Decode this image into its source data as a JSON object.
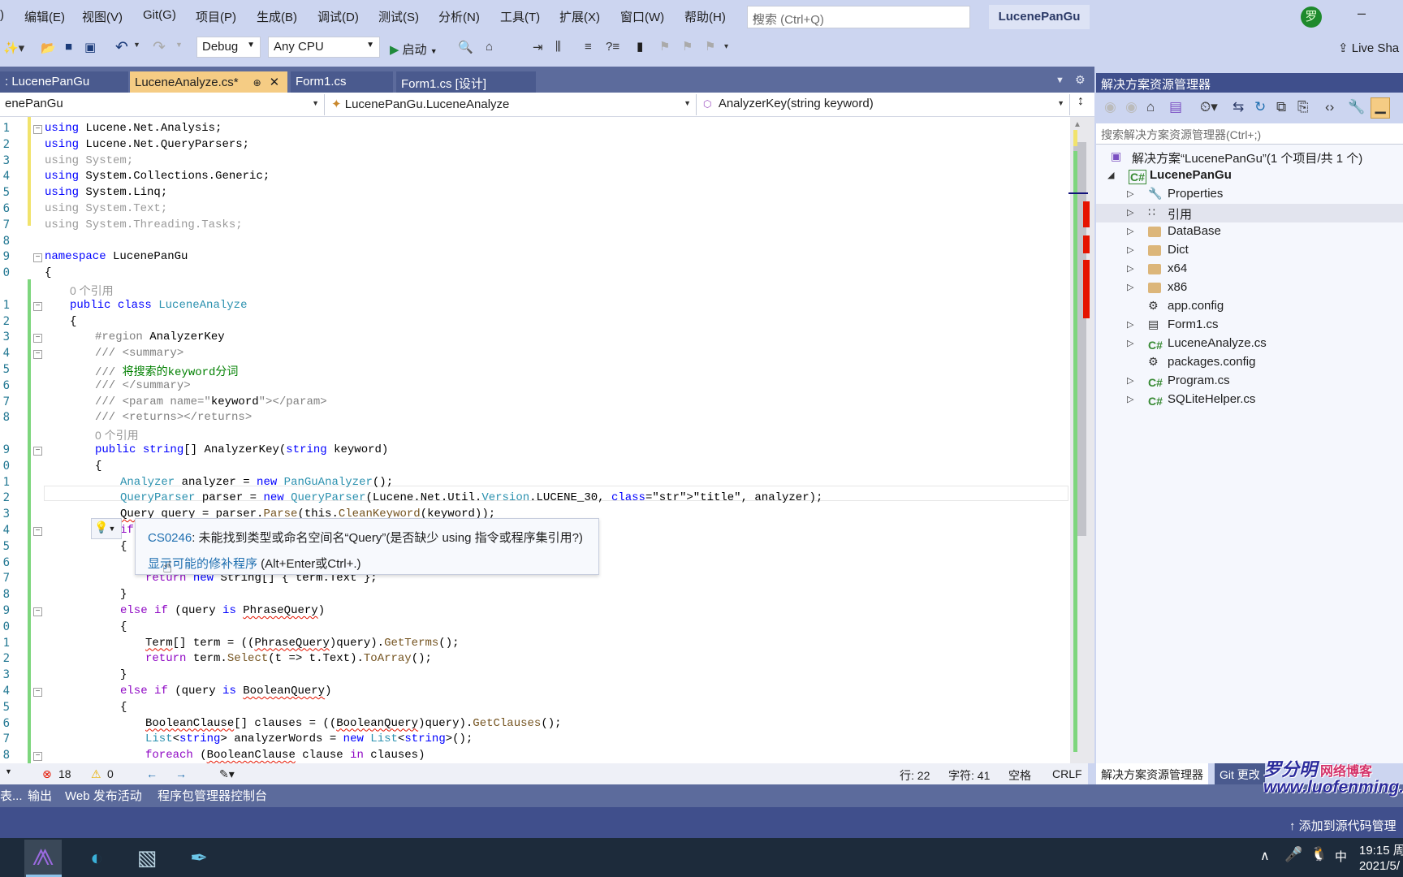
{
  "menu": [
    "编辑(E)",
    "视图(V)",
    "Git(G)",
    "项目(P)",
    "生成(B)",
    "调试(D)",
    "测试(S)",
    "分析(N)",
    "工具(T)",
    "扩展(X)",
    "窗口(W)",
    "帮助(H)"
  ],
  "menu_partial_first": ")",
  "search": {
    "placeholder": "搜索 (Ctrl+Q)"
  },
  "solution_name": "LucenePanGu",
  "avatar_initial": "罗",
  "toolbar": {
    "config": "Debug",
    "platform": "Any CPU",
    "start": "启动",
    "live_share": "Live Sha"
  },
  "tabs": [
    {
      "label": ": LucenePanGu",
      "active": false
    },
    {
      "label": "LuceneAnalyze.cs*",
      "active": true
    },
    {
      "label": "Form1.cs",
      "active": false
    },
    {
      "label": "Form1.cs [设计]",
      "active": false
    }
  ],
  "nav": {
    "project": "enePanGu",
    "type": "LucenePanGu.LuceneAnalyze",
    "member": "AnalyzerKey(string keyword)"
  },
  "code_lines": [
    {
      "n": "1",
      "text": "using Lucene.Net.Analysis;"
    },
    {
      "n": "2",
      "text": "using Lucene.Net.QueryParsers;"
    },
    {
      "n": "3",
      "text": "using System;"
    },
    {
      "n": "4",
      "text": "using System.Collections.Generic;"
    },
    {
      "n": "5",
      "text": "using System.Linq;"
    },
    {
      "n": "6",
      "text": "using System.Text;"
    },
    {
      "n": "7",
      "text": "using System.Threading.Tasks;"
    },
    {
      "n": "8",
      "text": ""
    },
    {
      "n": "9",
      "text": "namespace LucenePanGu"
    },
    {
      "n": "0",
      "text": "{"
    },
    {
      "n": "",
      "text": "0 个引用"
    },
    {
      "n": "1",
      "text": "public class LuceneAnalyze"
    },
    {
      "n": "2",
      "text": "{"
    },
    {
      "n": "3",
      "text": "#region AnalyzerKey"
    },
    {
      "n": "4",
      "text": "/// <summary>"
    },
    {
      "n": "5",
      "text": "/// 将搜索的keyword分词"
    },
    {
      "n": "6",
      "text": "/// </summary>"
    },
    {
      "n": "7",
      "text": "/// <param name=\"keyword\"></param>"
    },
    {
      "n": "8",
      "text": "/// <returns></returns>"
    },
    {
      "n": "",
      "text": "0 个引用"
    },
    {
      "n": "9",
      "text": "public string[] AnalyzerKey(string keyword)"
    },
    {
      "n": "0",
      "text": "{"
    },
    {
      "n": "1",
      "text": "Analyzer analyzer = new PanGuAnalyzer();"
    },
    {
      "n": "2",
      "text": "QueryParser parser = new QueryParser(Lucene.Net.Util.Version.LUCENE_30, \"title\", analyzer);"
    },
    {
      "n": "3",
      "text": "Query query = parser.Parse(this.CleanKeyword(keyword));"
    },
    {
      "n": "4",
      "text": "if"
    },
    {
      "n": "5",
      "text": "{"
    },
    {
      "n": "6",
      "text": ""
    },
    {
      "n": "7",
      "text": "return new String[] { term.Text };"
    },
    {
      "n": "8",
      "text": "}"
    },
    {
      "n": "9",
      "text": "else if (query is PhraseQuery)"
    },
    {
      "n": "0",
      "text": "{"
    },
    {
      "n": "1",
      "text": "Term[] term = ((PhraseQuery)query).GetTerms();"
    },
    {
      "n": "2",
      "text": "return term.Select(t => t.Text).ToArray();"
    },
    {
      "n": "3",
      "text": "}"
    },
    {
      "n": "4",
      "text": "else if (query is BooleanQuery)"
    },
    {
      "n": "5",
      "text": "{"
    },
    {
      "n": "6",
      "text": "BooleanClause[] clauses = ((BooleanQuery)query).GetClauses();"
    },
    {
      "n": "7",
      "text": "List<string> analyzerWords = new List<string>();"
    },
    {
      "n": "8",
      "text": "foreach (BooleanClause clause in clauses)"
    }
  ],
  "quickinfo": {
    "error_code": "CS0246",
    "error_text": ": 未能找到类型或命名空间名“Query”(是否缺少 using 指令或程序集引用?)",
    "fix_link": "显示可能的修补程序",
    "fix_shortcut": " (Alt+Enter或Ctrl+.)"
  },
  "status": {
    "errors": "18",
    "warnings": "0",
    "line": "行: 22",
    "char": "字符: 41",
    "indent": "空格",
    "eol": "CRLF"
  },
  "solution_explorer": {
    "title": "解决方案资源管理器",
    "search_placeholder": "搜索解决方案资源管理器(Ctrl+;)",
    "solution_label": "解决方案“LucenePanGu”(1 个项目/共 1 个)",
    "project": "LucenePanGu",
    "items": [
      {
        "label": "Properties",
        "icon": "wrench",
        "expandable": true
      },
      {
        "label": "引用",
        "icon": "references",
        "expandable": true,
        "selected": true
      },
      {
        "label": "DataBase",
        "icon": "folder",
        "expandable": true
      },
      {
        "label": "Dict",
        "icon": "folder",
        "expandable": true
      },
      {
        "label": "x64",
        "icon": "folder",
        "expandable": true
      },
      {
        "label": "x86",
        "icon": "folder",
        "expandable": true
      },
      {
        "label": "app.config",
        "icon": "config",
        "expandable": false
      },
      {
        "label": "Form1.cs",
        "icon": "form",
        "expandable": true
      },
      {
        "label": "LuceneAnalyze.cs",
        "icon": "csharp",
        "expandable": true
      },
      {
        "label": "packages.config",
        "icon": "config",
        "expandable": false
      },
      {
        "label": "Program.cs",
        "icon": "csharp",
        "expandable": true
      },
      {
        "label": "SQLiteHelper.cs",
        "icon": "csharp",
        "expandable": true
      }
    ],
    "bottom_tabs": [
      "解决方案资源管理器",
      "Git 更改"
    ]
  },
  "output_tabs": [
    "表...",
    "输出",
    "Web 发布活动",
    "程序包管理器控制台"
  ],
  "source_control": "添加到源代码管理",
  "taskbar": {
    "time": "19:15 周",
    "date": "2021/5/",
    "ime": "中"
  },
  "watermark": {
    "name": "罗分明",
    "tag": "网络博客",
    "url": "www.luofenming.com"
  }
}
